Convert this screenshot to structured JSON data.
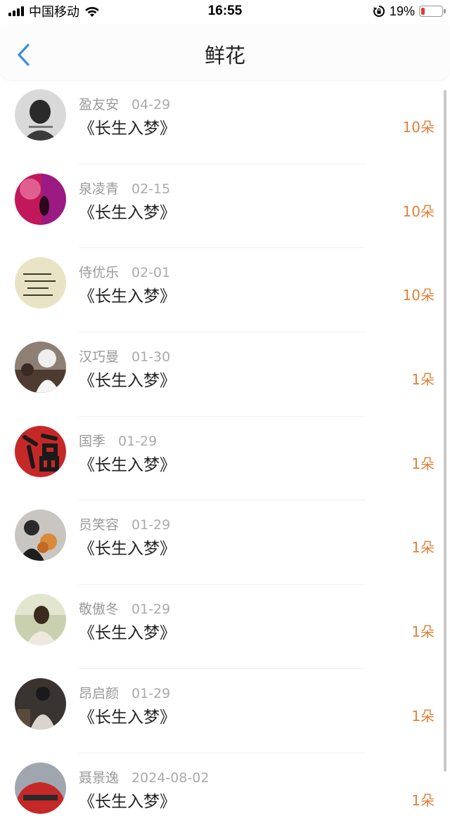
{
  "status_bar": {
    "carrier": "中国移动",
    "time": "16:55",
    "battery_pct": "19%",
    "battery_level": 0.19
  },
  "header": {
    "title": "鲜花"
  },
  "items": [
    {
      "name": "盈友安",
      "date": "04-29",
      "work": "《长生入梦》",
      "count": "10朵"
    },
    {
      "name": "泉凌青",
      "date": "02-15",
      "work": "《长生入梦》",
      "count": "10朵"
    },
    {
      "name": "侍优乐",
      "date": "02-01",
      "work": "《长生入梦》",
      "count": "10朵"
    },
    {
      "name": "汉巧曼",
      "date": "01-30",
      "work": "《长生入梦》",
      "count": "1朵"
    },
    {
      "name": "国季",
      "date": "01-29",
      "work": "《长生入梦》",
      "count": "1朵"
    },
    {
      "name": "员笑容",
      "date": "01-29",
      "work": "《长生入梦》",
      "count": "1朵"
    },
    {
      "name": "敬傲冬",
      "date": "01-29",
      "work": "《长生入梦》",
      "count": "1朵"
    },
    {
      "name": "昂启颜",
      "date": "01-29",
      "work": "《长生入梦》",
      "count": "1朵"
    },
    {
      "name": "聂景逸",
      "date": "2024-08-02",
      "work": "《长生入梦》",
      "count": "1朵"
    }
  ]
}
